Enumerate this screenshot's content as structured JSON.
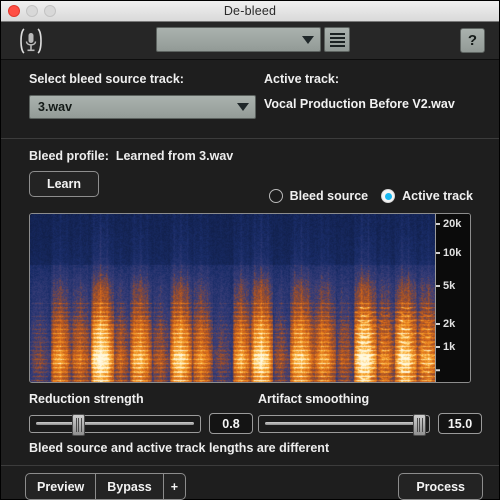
{
  "window": {
    "title": "De-bleed",
    "traffic_lights": [
      "close",
      "minimize",
      "maximize"
    ]
  },
  "toolbar": {
    "plugin_icon": "microphone-icon",
    "preset_value": "",
    "preset_placeholder": "",
    "menu_icon": "hamburger-menu-icon",
    "help_label": "?"
  },
  "track_section": {
    "bleed_source_label": "Select bleed source track:",
    "bleed_source_value": "3.wav",
    "active_track_label": "Active track:",
    "active_track_value": "Vocal Production Before V2.wav"
  },
  "profile_section": {
    "profile_label": "Bleed profile:",
    "profile_value": "Learned from 3.wav",
    "learn_label": "Learn",
    "radios": [
      {
        "label": "Bleed source",
        "selected": false
      },
      {
        "label": "Active track",
        "selected": true
      }
    ],
    "accent_color": "#16b7f0"
  },
  "spectrogram": {
    "freq_ticks": [
      "20k",
      "10k",
      "5k",
      "2k",
      "1k"
    ],
    "colormap": [
      "#10204a",
      "#2a3f7a",
      "#d9641a",
      "#f59a28",
      "#ffd98a",
      "#fff4d0"
    ]
  },
  "sliders": [
    {
      "label": "Reduction strength",
      "value": "0.8",
      "position_pct": 28
    },
    {
      "label": "Artifact smoothing",
      "value": "15.0",
      "position_pct": 94
    }
  ],
  "status": {
    "message": "Bleed source and active track lengths are different"
  },
  "bottom": {
    "buttons": [
      "Preview",
      "Bypass",
      "+"
    ],
    "process_label": "Process"
  }
}
